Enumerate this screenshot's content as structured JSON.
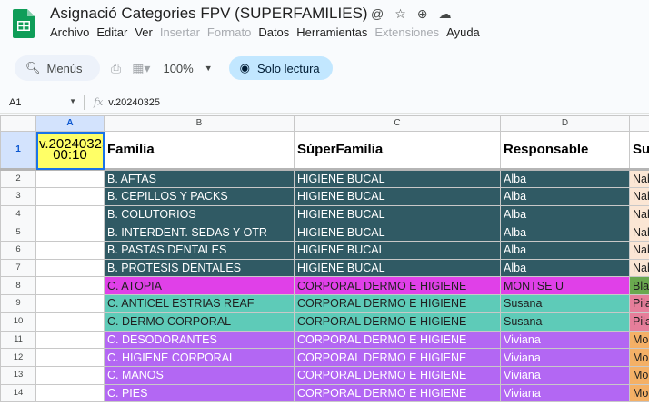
{
  "app": {
    "title": "Asignació Categories FPV (SUPERFAMILIES)",
    "title_icons": [
      "at-icon",
      "star-icon",
      "add-drive-icon",
      "cloud-status-icon"
    ]
  },
  "menubar": {
    "items": [
      {
        "label": "Archivo",
        "enabled": true
      },
      {
        "label": "Editar",
        "enabled": true
      },
      {
        "label": "Ver",
        "enabled": true
      },
      {
        "label": "Insertar",
        "enabled": false
      },
      {
        "label": "Formato",
        "enabled": false
      },
      {
        "label": "Datos",
        "enabled": true
      },
      {
        "label": "Herramientas",
        "enabled": true
      },
      {
        "label": "Extensiones",
        "enabled": false
      },
      {
        "label": "Ayuda",
        "enabled": true
      }
    ]
  },
  "toolbar": {
    "menus_label": "Menús",
    "zoom": "100%",
    "readonly_label": "Solo lectura"
  },
  "formula_bar": {
    "cell_ref": "A1",
    "fx_label": "fx",
    "value": "v.20240325"
  },
  "grid": {
    "columns": [
      "A",
      "B",
      "C",
      "D"
    ],
    "header_row": {
      "row": "1",
      "a1_text": "v.20240325 00:10",
      "b": "Família",
      "c": "SúperFamília",
      "d": "Responsable",
      "e": "Su"
    },
    "rows": [
      {
        "row": "2",
        "b": "B. AFTAS",
        "c": "HIGIENE BUCAL",
        "d": "Alba",
        "e": "Nab",
        "group": "higiene",
        "etype": "nab"
      },
      {
        "row": "3",
        "b": "B. CEPILLOS Y PACKS",
        "c": "HIGIENE BUCAL",
        "d": "Alba",
        "e": "Nab",
        "group": "higiene",
        "etype": "nab"
      },
      {
        "row": "4",
        "b": "B. COLUTORIOS",
        "c": "HIGIENE BUCAL",
        "d": "Alba",
        "e": "Nab",
        "group": "higiene",
        "etype": "nab"
      },
      {
        "row": "5",
        "b": "B. INTERDENT. SEDAS Y OTR",
        "c": "HIGIENE BUCAL",
        "d": "Alba",
        "e": "Nab",
        "group": "higiene",
        "etype": "nab"
      },
      {
        "row": "6",
        "b": "B. PASTAS DENTALES",
        "c": "HIGIENE BUCAL",
        "d": "Alba",
        "e": "Nab",
        "group": "higiene",
        "etype": "nab"
      },
      {
        "row": "7",
        "b": "B. PROTESIS DENTALES",
        "c": "HIGIENE BUCAL",
        "d": "Alba",
        "e": "Nab",
        "group": "higiene",
        "etype": "nab"
      },
      {
        "row": "8",
        "b": "C. ATOPIA",
        "c": "CORPORAL DERMO E HIGIENE",
        "d": "MONTSE U",
        "e": "Bla",
        "group": "atopia",
        "etype": "bla"
      },
      {
        "row": "9",
        "b": "C. ANTICEL ESTRIAS REAF",
        "c": "CORPORAL DERMO E HIGIENE",
        "d": "Susana",
        "e": "Pila",
        "group": "anticel",
        "etype": "pil"
      },
      {
        "row": "10",
        "b": "C. DERMO CORPORAL",
        "c": "CORPORAL DERMO E HIGIENE",
        "d": "Susana",
        "e": "Pila",
        "group": "anticel",
        "etype": "pil"
      },
      {
        "row": "11",
        "b": "C. DESODORANTES",
        "c": "CORPORAL DERMO E HIGIENE",
        "d": "Viviana",
        "e": "Mo",
        "group": "viv",
        "etype": "mon"
      },
      {
        "row": "12",
        "b": "C. HIGIENE CORPORAL",
        "c": "CORPORAL DERMO E HIGIENE",
        "d": "Viviana",
        "e": "Mo",
        "group": "viv",
        "etype": "mon"
      },
      {
        "row": "13",
        "b": "C. MANOS",
        "c": "CORPORAL DERMO E HIGIENE",
        "d": "Viviana",
        "e": "Mo",
        "group": "viv",
        "etype": "mon"
      },
      {
        "row": "14",
        "b": "C. PIES",
        "c": "CORPORAL DERMO E HIGIENE",
        "d": "Viviana",
        "e": "Mo",
        "group": "viv",
        "etype": "mon"
      }
    ]
  }
}
